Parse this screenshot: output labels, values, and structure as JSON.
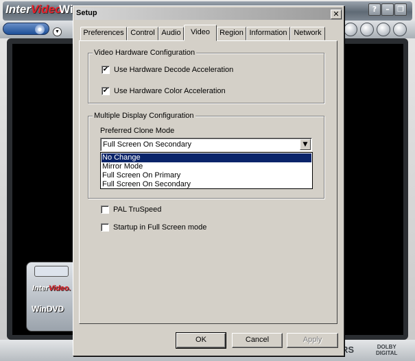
{
  "player": {
    "brand_inter": "Inter",
    "brand_video": "Video.",
    "brand_suffix": "Wi",
    "title_buttons": [
      "?",
      "–",
      "❐",
      "✕"
    ],
    "panel_brand_inter": "Inter",
    "panel_brand_video": "Video.",
    "panel_product": "WinDVD",
    "srs": "RS",
    "dolby": "DOLBY\nDIGITAL"
  },
  "dialog": {
    "title": "Setup",
    "close_symbol": "✕",
    "tabs": [
      "Preferences",
      "Control",
      "Audio",
      "Video",
      "Region",
      "Information",
      "Network"
    ],
    "active_tab": "Video",
    "video_hw_group": {
      "label": "Video Hardware Configuration",
      "options": [
        {
          "label": "Use Hardware Decode Acceleration",
          "checked": true
        },
        {
          "label": "Use Hardware Color Acceleration",
          "checked": true
        }
      ]
    },
    "display_group": {
      "label": "Multiple Display Configuration",
      "clone_label": "Preferred Clone Mode",
      "clone_value": "Full Screen On Secondary",
      "dropdown_arrow": "▼",
      "options": [
        "No Change",
        "Mirror Mode",
        "Full Screen On Primary",
        "Full Screen On Secondary"
      ],
      "highlighted_option": "No Change"
    },
    "other_options": [
      {
        "label": "PAL TruSpeed",
        "checked": false
      },
      {
        "label": "Startup in Full Screen mode",
        "checked": false
      }
    ],
    "buttons": {
      "ok": "OK",
      "cancel": "Cancel",
      "apply": "Apply"
    },
    "check_mark": "✔"
  }
}
